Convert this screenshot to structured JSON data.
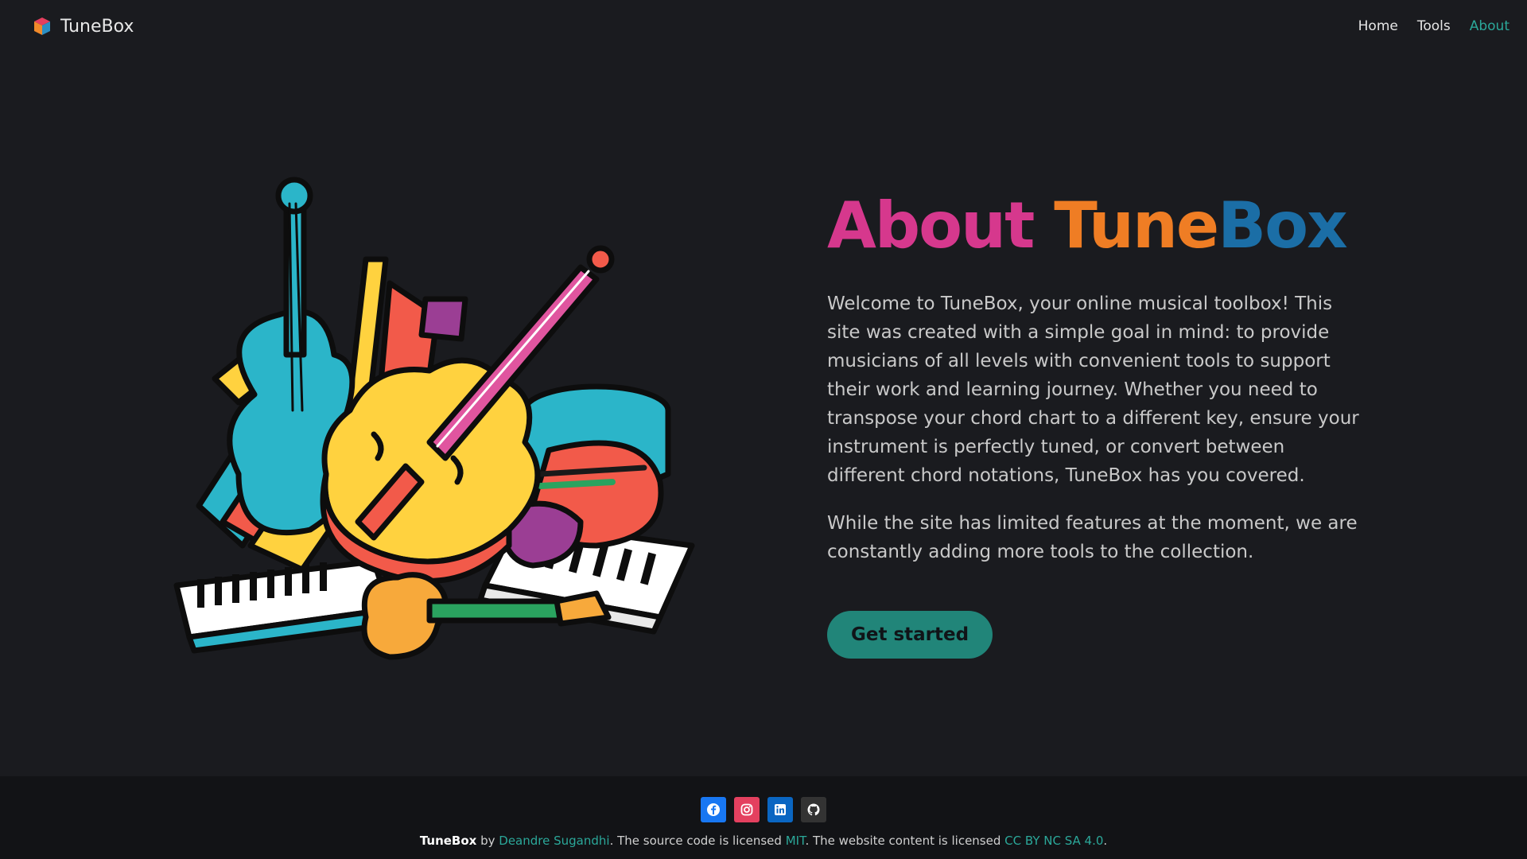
{
  "nav": {
    "brand": "TuneBox",
    "links": [
      {
        "label": "Home",
        "active": false
      },
      {
        "label": "Tools",
        "active": false
      },
      {
        "label": "About",
        "active": true
      }
    ]
  },
  "hero": {
    "title": {
      "about": "About",
      "tune": "Tune",
      "box": "Box"
    },
    "paragraph1": "Welcome to TuneBox, your online musical toolbox! This site was created with a simple goal in mind: to provide musicians of all levels with convenient tools to support their work and learning journey. Whether you need to transpose your chord chart to a different key, ensure your instrument is perfectly tuned, or convert between different chord notations, TuneBox has you covered.",
    "paragraph2": "While the site has limited features at the moment, we are constantly adding more tools to the collection.",
    "cta_label": "Get started"
  },
  "footer": {
    "socials": [
      "facebook-icon",
      "instagram-icon",
      "linkedin-icon",
      "github-icon"
    ],
    "brand": "TuneBox",
    "by": " by ",
    "author": "Deandre Sugandhi",
    "text1": ". The source code is licensed ",
    "code_license": "MIT",
    "text2": ". The website content is licensed ",
    "content_license": "CC BY NC SA 4.0",
    "text3": "."
  },
  "colors": {
    "accent": "#2ba89a",
    "title_about": "#d6388d",
    "title_tune": "#ef7d24",
    "title_box": "#1b6ea6",
    "cta_bg": "#218579"
  }
}
